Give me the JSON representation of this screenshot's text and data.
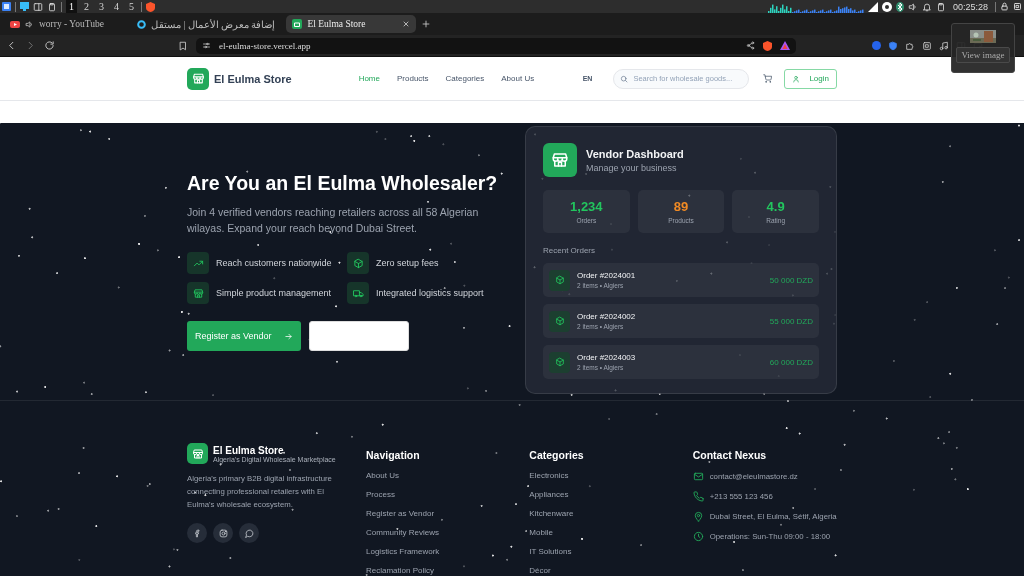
{
  "system_bar": {
    "workspaces": [
      {
        "label": "1",
        "selected": true
      },
      {
        "label": "2",
        "selected": false
      },
      {
        "label": "3",
        "selected": false
      },
      {
        "label": "4",
        "selected": false
      },
      {
        "label": "5",
        "selected": false
      }
    ],
    "clock": "00:25:28"
  },
  "browser": {
    "tabs": [
      {
        "title": "worry - YouTube",
        "kind": "video",
        "playing": true,
        "selected": false
      },
      {
        "title": "إضافة معرض الأعمال | مستقل",
        "kind": "ring",
        "playing": false,
        "selected": false
      },
      {
        "title": "El Eulma Store",
        "kind": "site",
        "playing": false,
        "selected": true
      }
    ],
    "url": "el-eulma-store.vercel.app"
  },
  "image_popup": {
    "button": "View image"
  },
  "header": {
    "brand": "El Eulma Store",
    "nav": [
      {
        "label": "Home",
        "selected": true
      },
      {
        "label": "Products",
        "selected": false
      },
      {
        "label": "Categories",
        "selected": false
      },
      {
        "label": "About Us",
        "selected": false
      }
    ],
    "language": "EN",
    "search": {
      "placeholder": "Search for wholesale goods..."
    },
    "login": "Login"
  },
  "hero": {
    "title": "Are You an El Eulma Wholesaler?",
    "description": "Join 4 verified vendors reaching retailers across all 58 Algerian wilayas. Expand your reach beyond Dubai Street.",
    "features": [
      {
        "label": "Reach customers nationwide",
        "kind": "trend"
      },
      {
        "label": "Zero setup fees",
        "kind": "box"
      },
      {
        "label": "Simple product management",
        "kind": "store"
      },
      {
        "label": "Integrated logistics support",
        "kind": "truck"
      }
    ],
    "buttons": [
      {
        "label": "Register as Vendor",
        "kind": "primary"
      },
      {
        "kind": "blank"
      }
    ]
  },
  "dashboard": {
    "title": "Vendor Dashboard",
    "subtitle": "Manage your business",
    "stats": [
      {
        "value": "1,234",
        "label": "Orders",
        "color": "#22c55e"
      },
      {
        "value": "89",
        "label": "Products",
        "color": "#f08a24"
      },
      {
        "value": "4.9",
        "label": "Rating",
        "color": "#22c55e"
      }
    ],
    "recent_title": "Recent Orders",
    "orders": [
      {
        "title": "Order #2024001",
        "meta": "2 items • Algiers",
        "amount": "50 000 DZD"
      },
      {
        "title": "Order #2024002",
        "meta": "2 items • Algiers",
        "amount": "55 000 DZD"
      },
      {
        "title": "Order #2024003",
        "meta": "2 items • Algiers",
        "amount": "60 000 DZD"
      }
    ]
  },
  "footer": {
    "brand": "El Eulma Store",
    "tagline": "Algeria's Digital Wholesale Marketplace",
    "description": "Algeria's primary B2B digital infrastructure connecting professional retailers with El Eulma's wholesale ecosystem.",
    "socials": [
      {
        "kind": "facebook"
      },
      {
        "kind": "instagram"
      },
      {
        "kind": "chat"
      }
    ],
    "columns": [
      {
        "title": "Navigation",
        "links": [
          "About Us",
          "Process",
          "Register as Vendor",
          "Community Reviews",
          "Logistics Framework",
          "Reclamation Policy"
        ]
      },
      {
        "title": "Categories",
        "links": [
          "Electronics",
          "Appliances",
          "Kitchenware",
          "Mobile",
          "IT Solutions",
          "Décor"
        ]
      }
    ],
    "contact": {
      "title": "Contact Nexus",
      "items": [
        {
          "kind": "email",
          "text": "contact@eleulmastore.dz"
        },
        {
          "kind": "phone",
          "text": "+213 555 123 456"
        },
        {
          "kind": "location",
          "text": "Dubai Street, El Eulma, Sétif, Algeria"
        },
        {
          "kind": "hours",
          "text": "Operations: Sun-Thu 09:00 - 18:00"
        }
      ]
    }
  }
}
